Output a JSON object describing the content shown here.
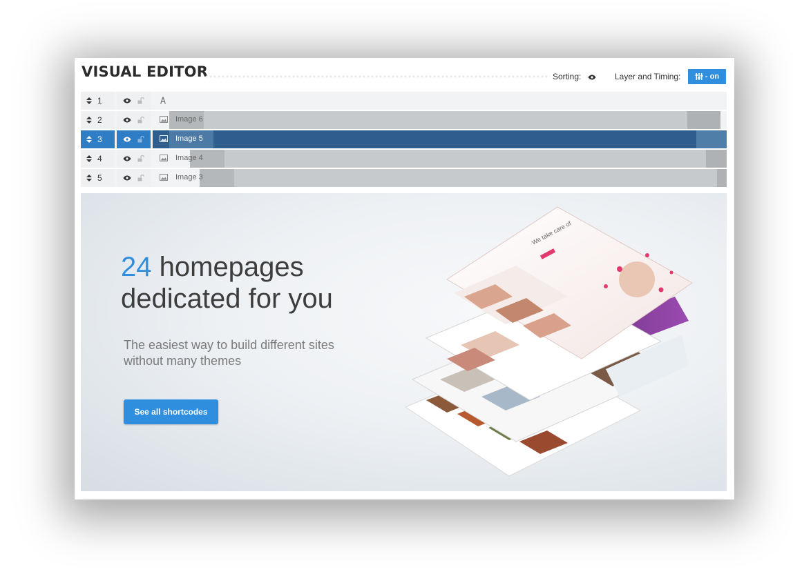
{
  "header": {
    "title": "VISUAL EDITOR",
    "sorting_label": "Sorting:",
    "layer_timing_label": "Layer and Timing:",
    "toggle_label": "- on"
  },
  "layers": [
    {
      "number": "1",
      "type": "text",
      "name": ""
    },
    {
      "number": "2",
      "type": "image",
      "name": "Image 6"
    },
    {
      "number": "3",
      "type": "image",
      "name": "Image 5",
      "active": true
    },
    {
      "number": "4",
      "type": "image",
      "name": "Image 4"
    },
    {
      "number": "5",
      "type": "image",
      "name": "Image 3"
    }
  ],
  "slide": {
    "headline_number": "24",
    "headline_rest": "homepages",
    "headline_line2": "dedicated for you",
    "subtitle_line1": "The easiest way to build different sites",
    "subtitle_line2": "without many themes",
    "cta_label": "See all shortcodes"
  },
  "colors": {
    "accent": "#2f8fde",
    "active_row": "#2f5d8e",
    "active_cell": "#2f7dc4",
    "timeline_bar": "#c6cacc"
  },
  "icons": {
    "sort": "sort-arrows-icon",
    "visibility": "eye-icon",
    "lock": "unlock-icon",
    "text_layer": "text-type-icon",
    "image_layer": "image-type-icon",
    "toggle": "sliders-icon"
  }
}
